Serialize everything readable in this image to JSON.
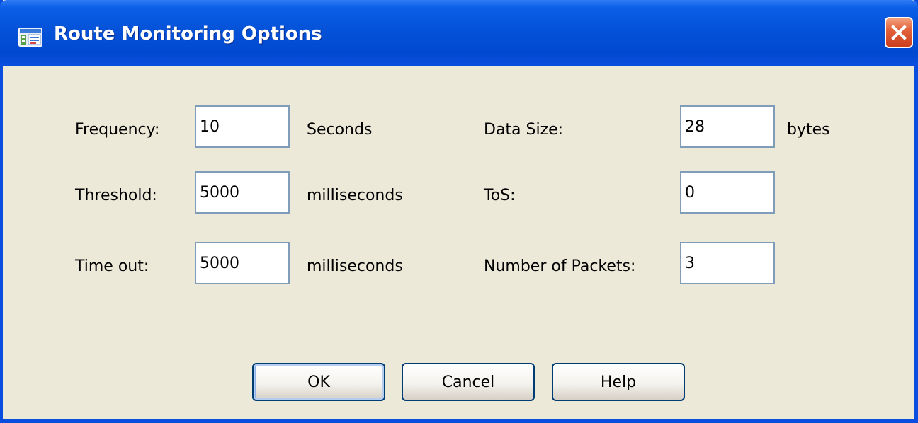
{
  "window": {
    "title": "Route Monitoring Options"
  },
  "icons": {
    "app": "app-window-icon",
    "close": "close-icon"
  },
  "colors": {
    "titlebar": "#0452d8",
    "dialog_background": "#ece9d8",
    "close_button": "#e2623a",
    "field_border": "#7f9db9",
    "button_border": "#003c74"
  },
  "fields": {
    "frequency": {
      "label": "Frequency:",
      "value": "10",
      "unit": "Seconds"
    },
    "threshold": {
      "label": "Threshold:",
      "value": "5000",
      "unit": "milliseconds"
    },
    "timeout": {
      "label": "Time out:",
      "value": "5000",
      "unit": "milliseconds"
    },
    "data_size": {
      "label": "Data Size:",
      "value": "28",
      "unit": "bytes"
    },
    "tos": {
      "label": "ToS:",
      "value": "0"
    },
    "num_packets": {
      "label": "Number of Packets:",
      "value": "3"
    }
  },
  "buttons": {
    "ok": "OK",
    "cancel": "Cancel",
    "help": "Help"
  }
}
